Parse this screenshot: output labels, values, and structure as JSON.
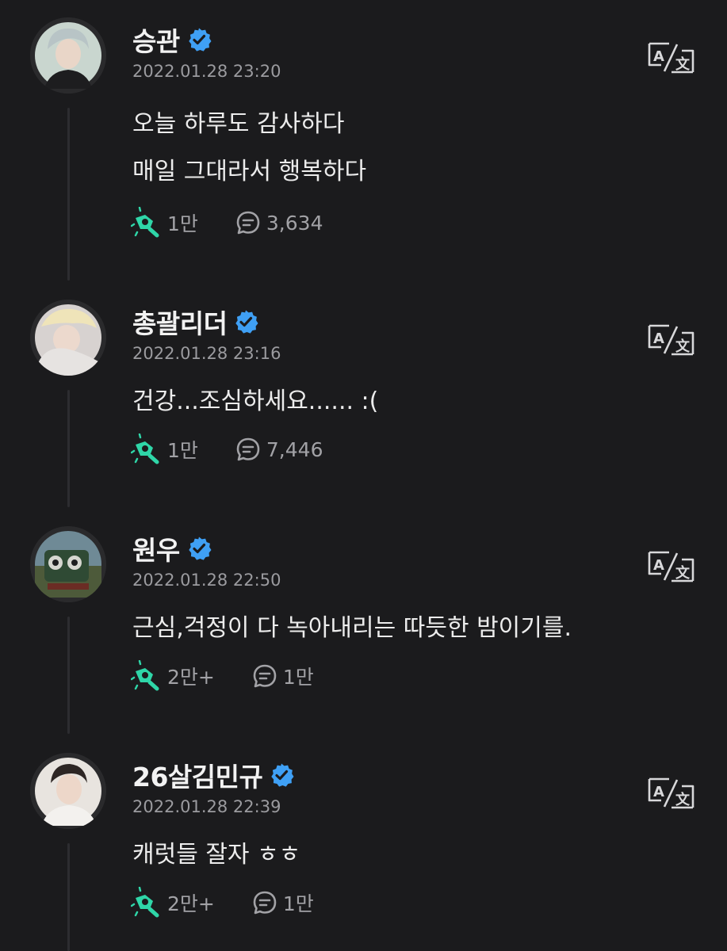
{
  "colors": {
    "background": "#1b1b1d",
    "accent_green": "#2fd6a8",
    "verified_blue": "#3fa0f5",
    "muted_text": "#9b9b9f"
  },
  "posts": [
    {
      "author": "승관",
      "verified_icon": "verified-badge-icon",
      "timestamp": "2022.01.28 23:20",
      "body": [
        "오늘 하루도 감사하다",
        "매일 그대라서 행복하다"
      ],
      "likes": "1만",
      "comments": "3,634",
      "translate_icon": "translate-icon"
    },
    {
      "author": "총괄리더",
      "verified_icon": "verified-badge-icon",
      "timestamp": "2022.01.28 23:16",
      "body": [
        "건강...조심하세요...... :("
      ],
      "likes": "1만",
      "comments": "7,446",
      "translate_icon": "translate-icon"
    },
    {
      "author": "원우",
      "verified_icon": "verified-badge-icon",
      "timestamp": "2022.01.28 22:50",
      "body": [
        "근심,걱정이 다 녹아내리는 따듯한 밤이기를."
      ],
      "likes": "2만+",
      "comments": "1만",
      "translate_icon": "translate-icon"
    },
    {
      "author": "26살김민규",
      "verified_icon": "verified-badge-icon",
      "timestamp": "2022.01.28 22:39",
      "body": [
        "캐럿들 잘자 ㅎㅎ"
      ],
      "likes": "2만+",
      "comments": "1만",
      "translate_icon": "translate-icon"
    }
  ]
}
